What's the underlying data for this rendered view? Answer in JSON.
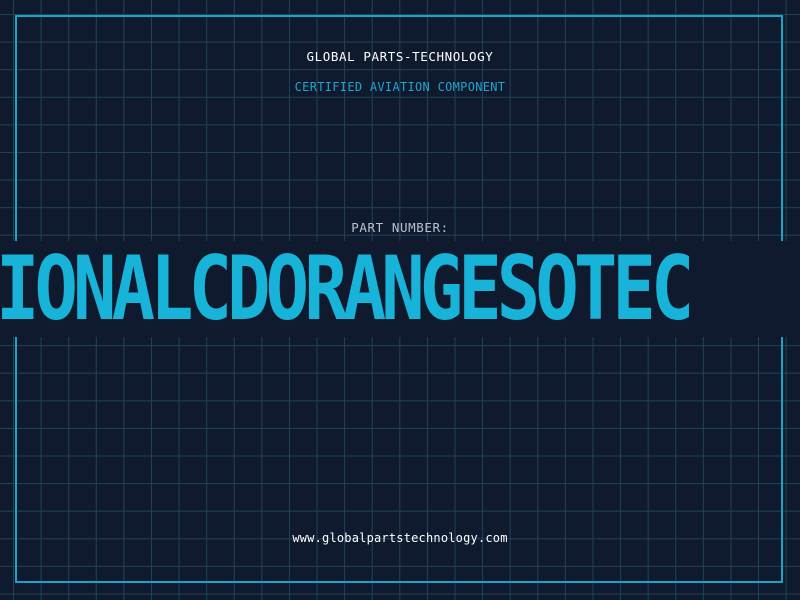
{
  "header": {
    "company": "GLOBAL PARTS-TECHNOLOGY",
    "subtitle": "CERTIFIED AVIATION COMPONENT"
  },
  "part": {
    "label": "PART NUMBER:",
    "number": "IONALCDORANGESOTEC"
  },
  "footer": {
    "website": "www.globalpartstechnology.com"
  },
  "colors": {
    "background": "#101a2f",
    "grid": "#1f4358",
    "accent": "#17b3d8",
    "text": "#ffffff",
    "muted_text": "#b8c2cf"
  }
}
